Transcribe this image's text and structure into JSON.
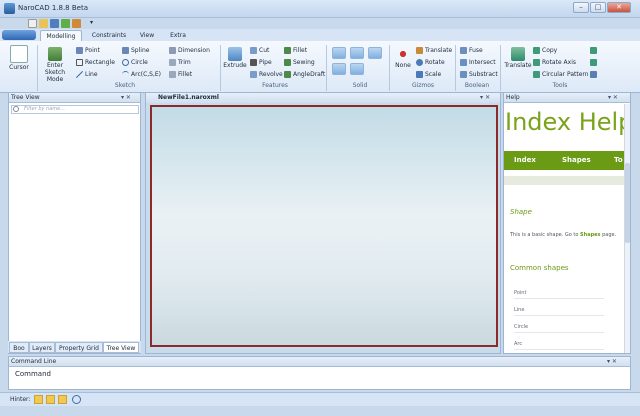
{
  "app": {
    "title": "NaroCAD 1.8.8 Beta"
  },
  "ribbon": {
    "tabs": [
      "Modelling",
      "Constraints",
      "View",
      "Extra"
    ],
    "cursor_label": "Cursor",
    "sketch": {
      "enter_label": "Enter Sketch Mode",
      "items": [
        "Point",
        "Rectangle",
        "Line",
        "Spline",
        "Circle",
        "Arc(C,S,E)",
        "Dimension",
        "Trim",
        "Fillet"
      ],
      "group": "Sketch"
    },
    "features": {
      "extrude": "Extrude",
      "items": [
        "Cut",
        "Pipe",
        "Revolve",
        "Fillet",
        "Sewing",
        "AngleDraft"
      ],
      "group": "Features"
    },
    "solid": {
      "group": "Solid"
    },
    "gizmos": {
      "none": "None",
      "items": [
        "Translate",
        "Rotate",
        "Scale"
      ],
      "group": "Gizmos"
    },
    "boolean": {
      "items": [
        "Fuse",
        "Intersect",
        "Substract"
      ],
      "group": "Boolean"
    },
    "tools": {
      "translate": "Translate",
      "items": [
        "Copy",
        "Rotate Axis",
        "Circular Pattern"
      ],
      "group": "Tools"
    }
  },
  "treeview": {
    "title": "Tree View",
    "filter_placeholder": "Filter by name...",
    "tabs": [
      "Boo",
      "Layers",
      "Property Grid",
      "Tree View"
    ]
  },
  "document": {
    "tab": "NewFile1.naroxml"
  },
  "help": {
    "title": "Help",
    "heading": "Index Help",
    "nav": [
      "Index",
      "Shapes",
      "To"
    ],
    "section": "Shape",
    "desc_prefix": "This is a basic shape. Go to",
    "desc_link": "Shapes",
    "desc_suffix": "page.",
    "common_heading": "Common shapes",
    "shapes": [
      "Point",
      "Line",
      "Circle",
      "Arc"
    ]
  },
  "commandline": {
    "title": "Command Line",
    "label": "Command"
  },
  "status": {
    "label": "Hinter:"
  },
  "colors": {
    "accent": "#6b9a14",
    "viewport_border": "#8a2a2a"
  }
}
